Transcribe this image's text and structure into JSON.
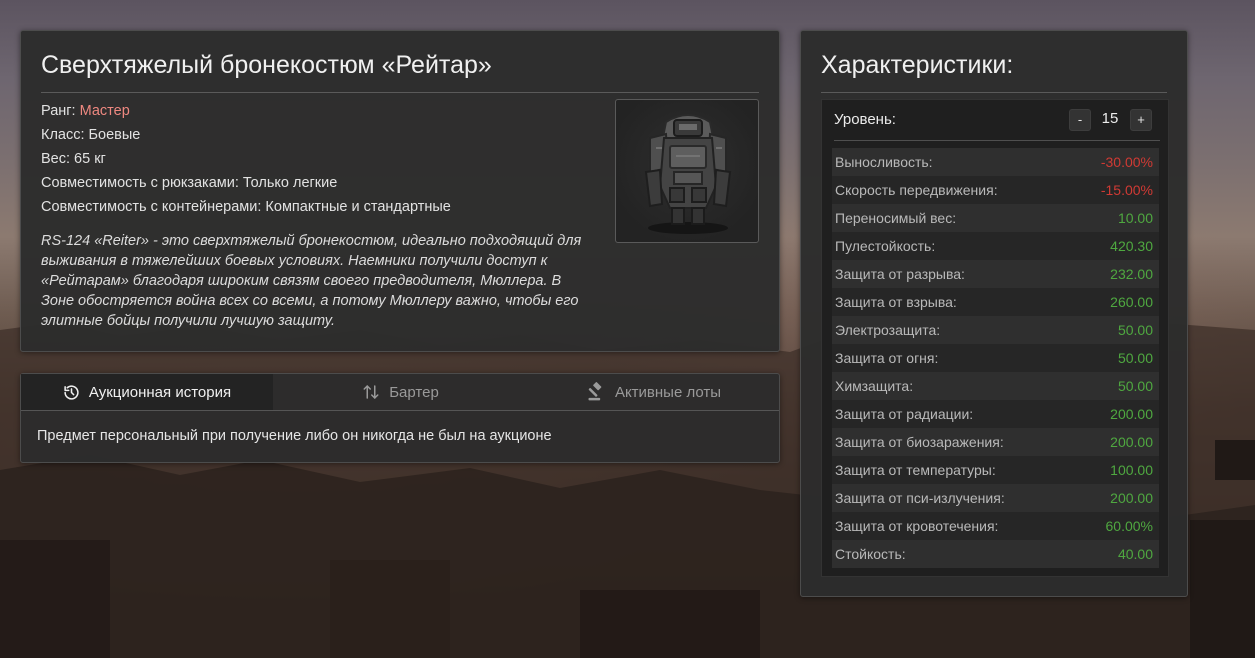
{
  "item": {
    "title": "Сверхтяжелый бронекостюм «Рейтар»",
    "rank_label": "Ранг:",
    "rank_value": "Мастер",
    "rank_color": "#ee8880",
    "class_line": "Класс: Боевые",
    "weight_line": "Вес: 65 кг",
    "backpack_line": "Совместимость с рюкзаками: Только легкие",
    "container_line": "Совместимость с контейнерами: Компактные и стандартные",
    "description": "RS-124 «Reiter» - это сверхтяжелый бронекостюм, идеально подходящий для выживания в тяжелейших боевых условиях. Наемники получили доступ к «Рейтарам» благодаря широким связям своего предводителя, Мюллера. В Зоне обостряется война всех со всеми, а потому Мюллеру важно, чтобы его элитные бойцы получили лучшую защиту.",
    "image_icon": "armor-suit-icon"
  },
  "tabs": [
    {
      "label": "Аукционная история",
      "icon": "history-icon",
      "active": true
    },
    {
      "label": "Бартер",
      "icon": "swap-arrows-icon",
      "active": false
    },
    {
      "label": "Активные лоты",
      "icon": "gavel-icon",
      "active": false
    }
  ],
  "tab_content": "Предмет персональный при получение либо он никогда не был на аукционе",
  "stats": {
    "title": "Характеристики:",
    "level_label": "Уровень:",
    "level_value": "15",
    "dec_label": "-",
    "inc_label": "+",
    "positive_color": "#4fa840",
    "negative_color": "#d03a34",
    "rows": [
      {
        "name": "Выносливость:",
        "value": "-30.00%",
        "sign": "negative"
      },
      {
        "name": "Скорость передвижения:",
        "value": "-15.00%",
        "sign": "negative"
      },
      {
        "name": "Переносимый вес:",
        "value": "10.00",
        "sign": "positive"
      },
      {
        "name": "Пулестойкость:",
        "value": "420.30",
        "sign": "positive"
      },
      {
        "name": "Защита от разрыва:",
        "value": "232.00",
        "sign": "positive"
      },
      {
        "name": "Защита от взрыва:",
        "value": "260.00",
        "sign": "positive"
      },
      {
        "name": "Электрозащита:",
        "value": "50.00",
        "sign": "positive"
      },
      {
        "name": "Защита от огня:",
        "value": "50.00",
        "sign": "positive"
      },
      {
        "name": "Химзащита:",
        "value": "50.00",
        "sign": "positive"
      },
      {
        "name": "Защита от радиации:",
        "value": "200.00",
        "sign": "positive"
      },
      {
        "name": "Защита от биозаражения:",
        "value": "200.00",
        "sign": "positive"
      },
      {
        "name": "Защита от температуры:",
        "value": "100.00",
        "sign": "positive"
      },
      {
        "name": "Защита от пси-излучения:",
        "value": "200.00",
        "sign": "positive"
      },
      {
        "name": "Защита от кровотечения:",
        "value": "60.00%",
        "sign": "positive"
      },
      {
        "name": "Стойкость:",
        "value": "40.00",
        "sign": "positive"
      }
    ]
  }
}
